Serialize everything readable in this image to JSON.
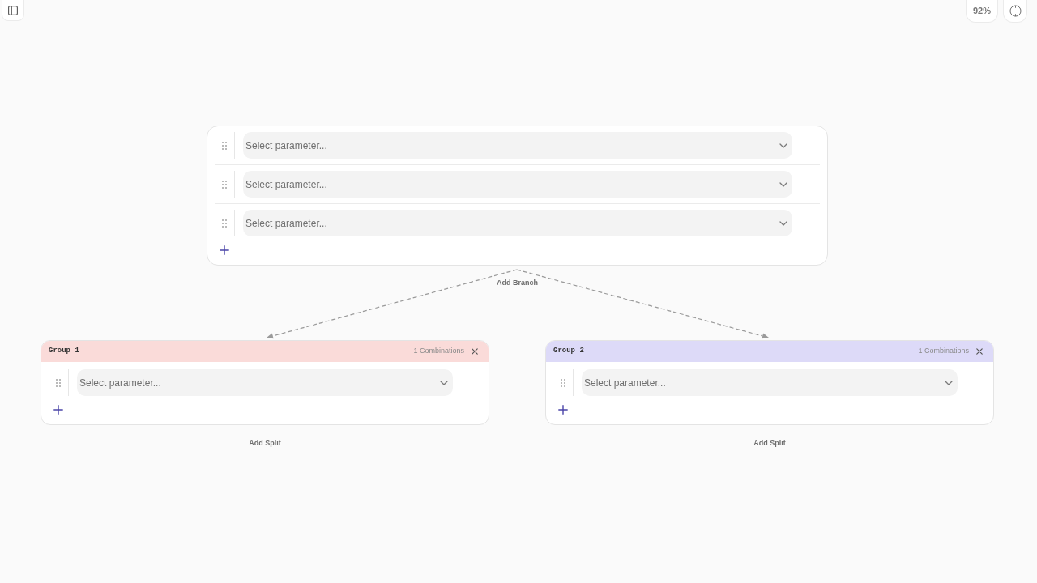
{
  "zoom_level": "92%",
  "root_node": {
    "rows": [
      {
        "placeholder": "Select parameter..."
      },
      {
        "placeholder": "Select parameter..."
      },
      {
        "placeholder": "Select parameter..."
      }
    ]
  },
  "branch_action": "Add Branch",
  "groups": [
    {
      "title": "Group 1",
      "color": "#fadbd9",
      "combinations": "1 Combinations",
      "rows": [
        {
          "placeholder": "Select parameter..."
        }
      ],
      "split_action": "Add Split"
    },
    {
      "title": "Group 2",
      "color": "#dddaf8",
      "combinations": "1 Combinations",
      "rows": [
        {
          "placeholder": "Select parameter..."
        }
      ],
      "split_action": "Add Split"
    }
  ]
}
